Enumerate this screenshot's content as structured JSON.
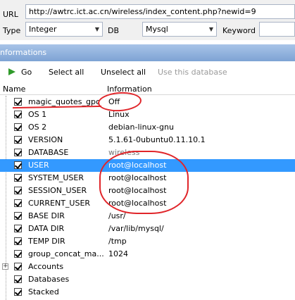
{
  "topbar": {
    "url_label": "URL",
    "url_value": "http://awtrc.ict.ac.cn/wireless/index_content.php?newid=9",
    "type_label": "Type",
    "type_value": "Integer",
    "db_label": "DB",
    "db_value": "Mysql",
    "keyword_label": "Keyword",
    "keyword_value": ""
  },
  "section_title": "nformations",
  "toolbar": {
    "go_label": "Go",
    "select_all_label": "Select all",
    "unselect_all_label": "Unselect all",
    "use_db_label": "Use this database"
  },
  "columns": {
    "name": "Name",
    "info": "Information"
  },
  "rows": [
    {
      "name": "magic_quotes_gpc",
      "value": "Off"
    },
    {
      "name": "OS 1",
      "value": "Linux"
    },
    {
      "name": "OS 2",
      "value": "debian-linux-gnu"
    },
    {
      "name": "VERSION",
      "value": "5.1.61-0ubuntu0.11.10.1"
    },
    {
      "name": "DATABASE",
      "value": "wireless"
    },
    {
      "name": "USER",
      "value": "root@localhost",
      "selected": true
    },
    {
      "name": "SYSTEM_USER",
      "value": "root@localhost"
    },
    {
      "name": "SESSION_USER",
      "value": "root@localhost"
    },
    {
      "name": "CURRENT_USER",
      "value": "root@localhost"
    },
    {
      "name": "BASE DIR",
      "value": "/usr/"
    },
    {
      "name": "DATA DIR",
      "value": "/var/lib/mysql/"
    },
    {
      "name": "TEMP DIR",
      "value": "/tmp"
    },
    {
      "name": "group_concat_ma...",
      "value": "1024"
    },
    {
      "name": "Accounts",
      "value": ""
    },
    {
      "name": "Databases",
      "value": ""
    },
    {
      "name": "Stacked",
      "value": ""
    }
  ],
  "colors": {
    "selected_row": "#3399ff",
    "annotation_red": "#e0252a",
    "header_blue": "#7ea3d4"
  }
}
